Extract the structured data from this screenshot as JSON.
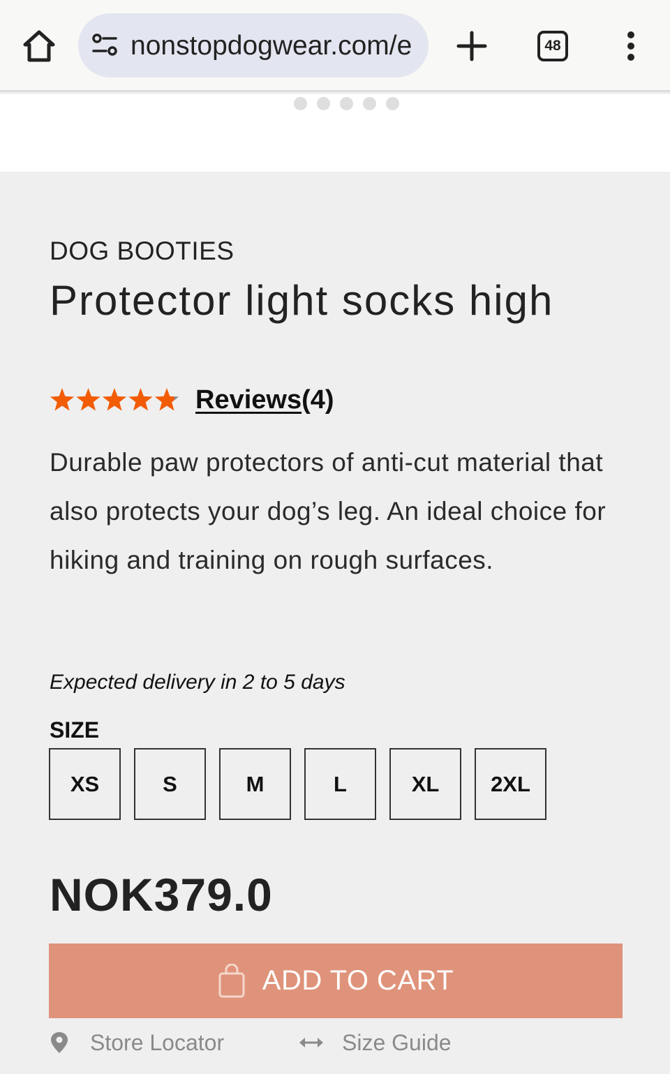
{
  "browser": {
    "url": "nonstopdogwear.com/e",
    "tab_count": "48",
    "icons": [
      "home-icon",
      "site-settings-icon",
      "new-tab-icon",
      "tab-switcher-icon",
      "overflow-menu-icon"
    ]
  },
  "carousel": {
    "dot_count": 5
  },
  "product": {
    "category": "DOG BOOTIES",
    "title": "Protector light socks high",
    "rating": 4.8,
    "rating_max": 5,
    "reviews_label": "Reviews",
    "reviews_count": "(4)",
    "description": "Durable paw protectors of anti-cut material that also protects your dog’s leg. An ideal choice for hiking and training on rough surfaces.",
    "delivery": "Expected delivery in 2 to 5 days",
    "size_label": "SIZE",
    "sizes": [
      "XS",
      "S",
      "M",
      "L",
      "XL",
      "2XL"
    ],
    "price": "NOK379.0",
    "add_to_cart": "ADD TO CART",
    "store_locator": "Store Locator",
    "size_guide": "Size Guide"
  },
  "colors": {
    "star": "#f25c05",
    "star_empty": "#8a8a8a",
    "cart_button": "#df937a",
    "page_background": "#efefef"
  }
}
